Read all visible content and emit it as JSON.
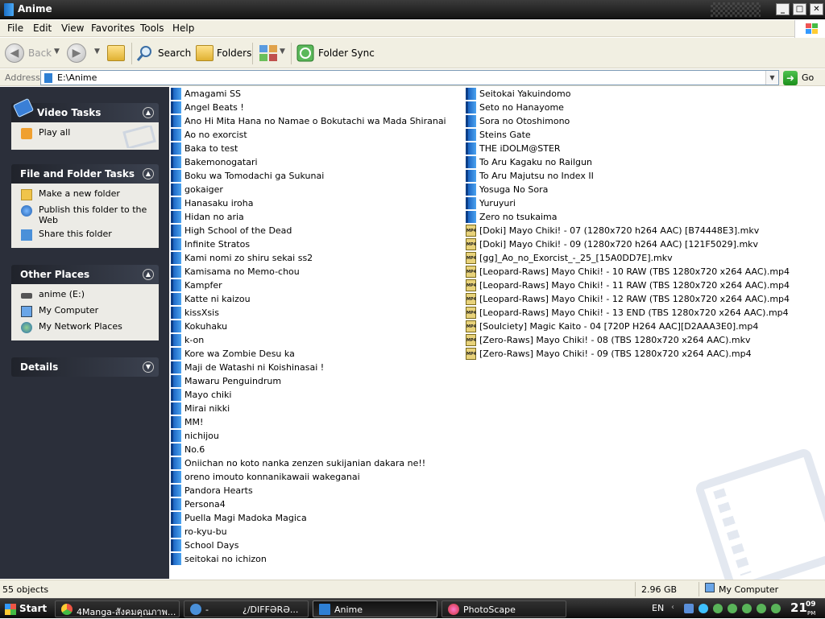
{
  "window": {
    "title": "Anime"
  },
  "menu": [
    "File",
    "Edit",
    "View",
    "Favorites",
    "Tools",
    "Help"
  ],
  "toolbar": {
    "back_label": "Back",
    "search_label": "Search",
    "folders_label": "Folders",
    "folder_sync_label": "Folder Sync"
  },
  "address": {
    "label": "Address",
    "value": "E:\\Anime",
    "go_label": "Go"
  },
  "taskpane": {
    "video_tasks": {
      "title": "Video Tasks",
      "items": [
        "Play all"
      ]
    },
    "file_folder_tasks": {
      "title": "File and Folder Tasks",
      "items": [
        "Make a new folder",
        "Publish this folder to the Web",
        "Share this folder"
      ]
    },
    "other_places": {
      "title": "Other Places",
      "items": [
        "anime (E:)",
        "My Computer",
        "My Network Places"
      ]
    },
    "details": {
      "title": "Details"
    }
  },
  "files": {
    "column1": [
      "Amagami SS",
      "Angel Beats !",
      "Ano Hi Mita Hana no Namae o Bokutachi wa Mada Shiranai",
      "Ao no exorcist",
      "Baka to test",
      "Bakemonogatari",
      "Boku wa Tomodachi ga Sukunai",
      "gokaiger",
      "Hanasaku iroha",
      "Hidan no aria",
      "High School of the Dead",
      "Infinite Stratos",
      "Kami nomi zo shiru sekai ss2",
      "Kamisama no Memo-chou",
      "Kampfer",
      "Katte ni kaizou",
      "kissXsis",
      "Kokuhaku",
      "k-on",
      "Kore wa Zombie Desu ka",
      "Maji de Watashi ni Koishinasai !",
      "Mawaru Penguindrum",
      "Mayo chiki",
      "Mirai nikki",
      "MM!",
      "nichijou",
      "No.6",
      "Oniichan no koto nanka zenzen sukijanian dakara ne!!",
      "oreno imouto konnanikawaii wakeganai",
      "Pandora Hearts",
      "Persona4",
      "Puella Magi Madoka Magica",
      "ro-kyu-bu",
      "School Days",
      "seitokai no ichizon"
    ],
    "column2_folders": [
      "Seitokai Yakuindomo",
      "Seto no Hanayome",
      "Sora no Otoshimono",
      "Steins Gate",
      "THE iDOLM@STER",
      "To Aru Kagaku no Railgun",
      "To Aru Majutsu no Index II",
      "Yosuga No Sora",
      "Yuruyuri",
      "Zero no tsukaima"
    ],
    "column2_videos": [
      "[Doki] Mayo Chiki! - 07 (1280x720 h264 AAC) [B74448E3].mkv",
      "[Doki] Mayo Chiki! - 09 (1280x720 h264 AAC) [121F5029].mkv",
      "[gg]_Ao_no_Exorcist_-_25_[15A0DD7E].mkv",
      "[Leopard-Raws] Mayo Chiki! - 10 RAW (TBS 1280x720 x264 AAC).mp4",
      "[Leopard-Raws] Mayo Chiki! - 11 RAW (TBS 1280x720 x264 AAC).mp4",
      "[Leopard-Raws] Mayo Chiki! - 12 RAW (TBS 1280x720 x264 AAC).mp4",
      "[Leopard-Raws] Mayo Chiki! - 13 END (TBS 1280x720 x264 AAC).mp4",
      "[Soulciety] Magic Kaito - 04 [720P H264 AAC][D2AAA3E0].mp4",
      "[Zero-Raws] Mayo Chiki! - 08 (TBS 1280x720 x264 AAC).mkv",
      "[Zero-Raws] Mayo Chiki! - 09 (TBS 1280x720 x264 AAC).mp4"
    ]
  },
  "status": {
    "objects": "55 objects",
    "size": "2.96 GB",
    "location": "My Computer"
  },
  "taskbar": {
    "start_label": "Start",
    "tasks": [
      "4Manga-สังคมคุณภาพ...",
      "-",
      "¿/DIFFƏRƏ...",
      "Anime",
      "PhotoScape"
    ],
    "language": "EN",
    "clock_hour": "21",
    "clock_minute": "09",
    "clock_period": "PM"
  },
  "colors": {
    "titlebar": "#141414",
    "taskpane": "#2b2f3a",
    "folder_icon": "#2e7fd3",
    "go_green": "#1b8f1b"
  }
}
